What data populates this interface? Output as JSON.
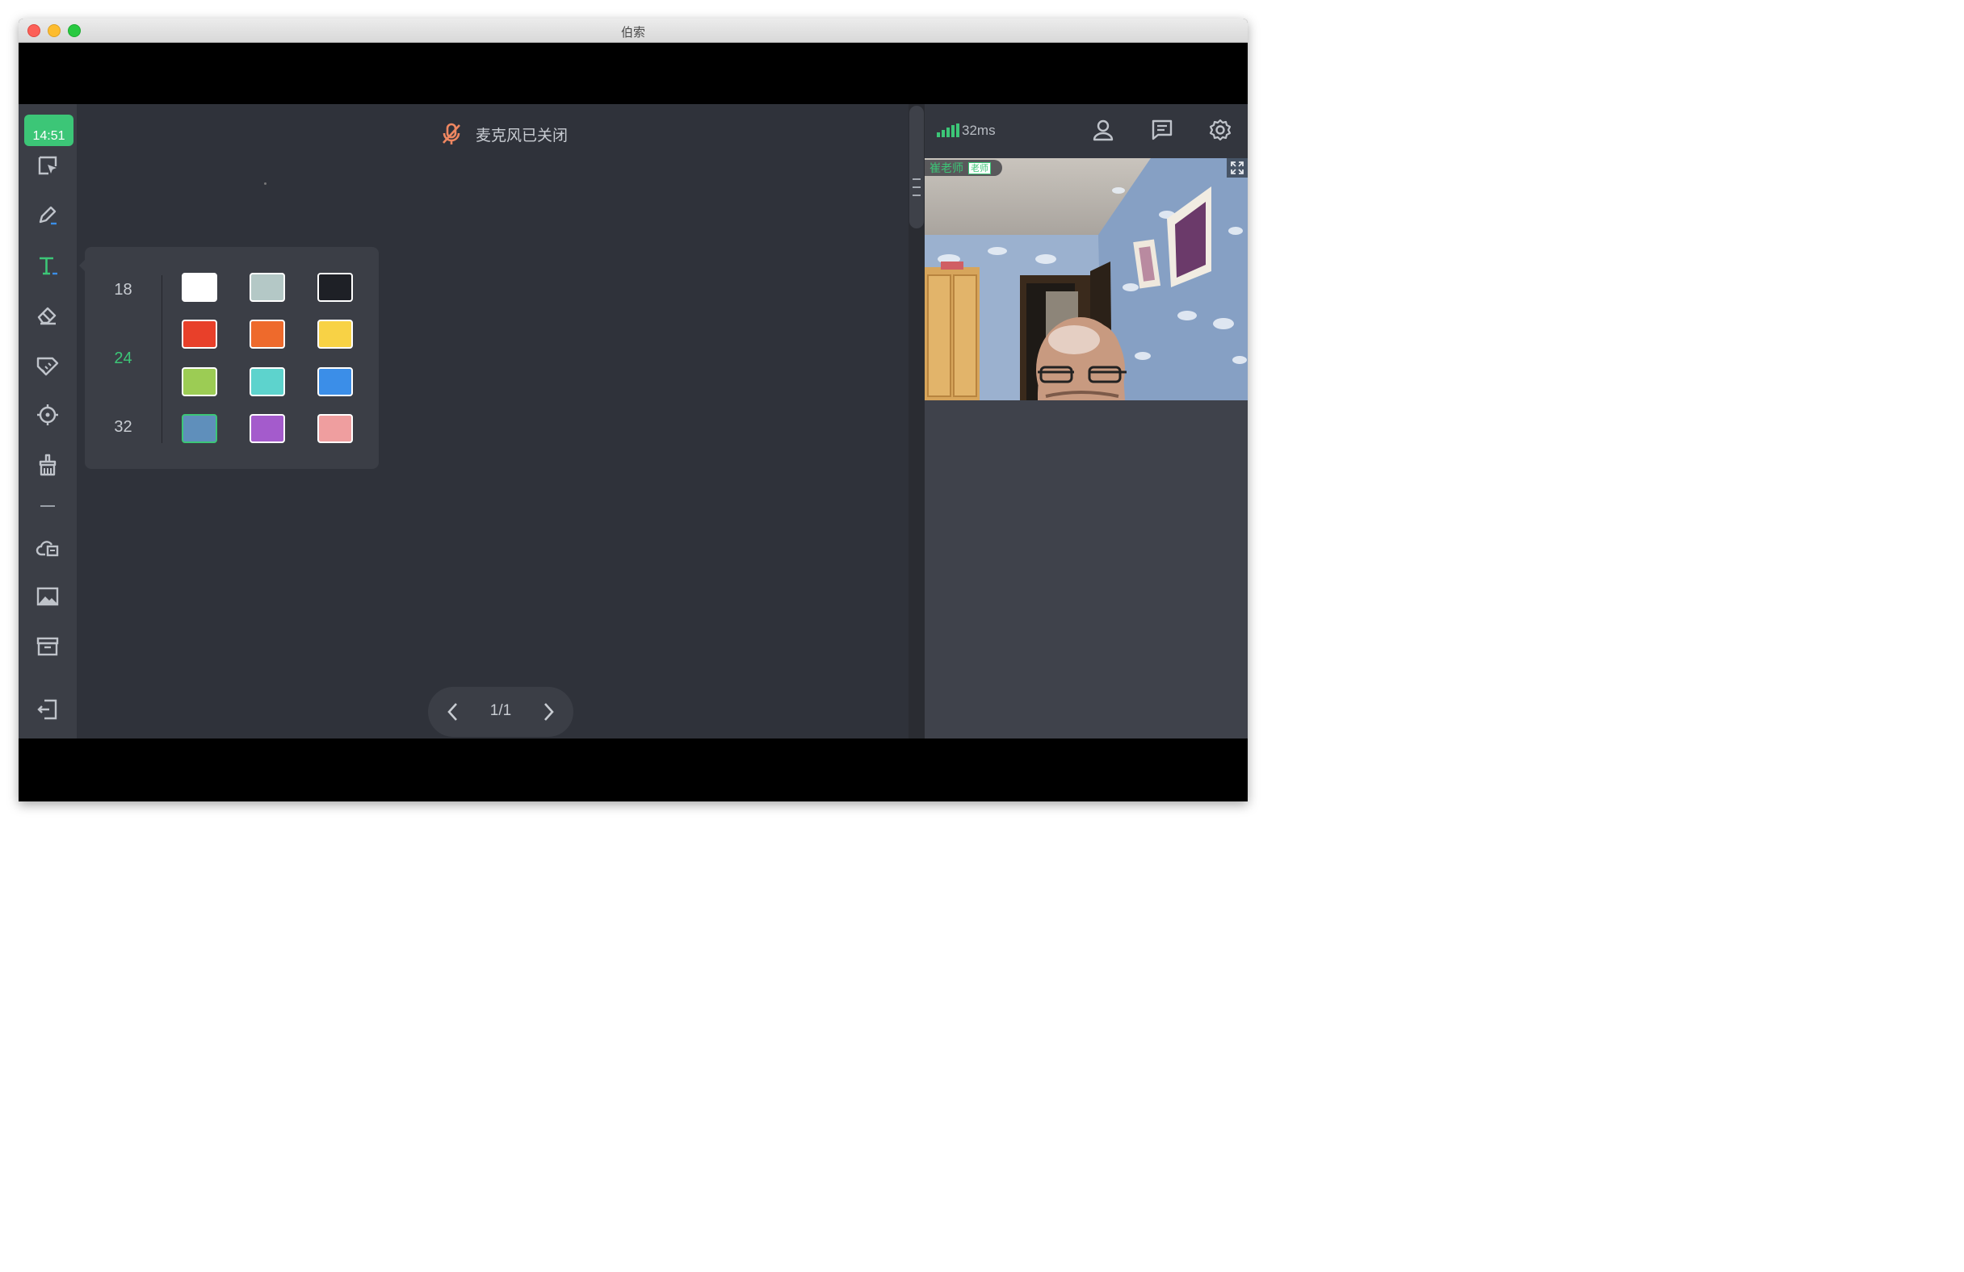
{
  "window": {
    "title": "伯索"
  },
  "sidebar": {
    "clock": "14:51",
    "tools": [
      "select-tool",
      "pen-tool",
      "text-tool",
      "eraser-tool",
      "ruler-tool",
      "laser-pointer-tool",
      "clear-tool",
      "cloud-files-tool",
      "image-tool",
      "archive-tool",
      "exit-tool"
    ],
    "active_tool": "text-tool"
  },
  "board": {
    "mic_status": "麦克风已关闭",
    "page_indicator": "1/1"
  },
  "text_panel": {
    "sizes": [
      "18",
      "24",
      "32"
    ],
    "active_size": "24",
    "colors": [
      "#ffffff",
      "#b4c8c6",
      "#1e2026",
      "#e8402a",
      "#ee6a2c",
      "#f8d245",
      "#9ccc54",
      "#5dd3cd",
      "#3b8ee8",
      "#5f8fbb",
      "#a45bcc",
      "#ef9e9f"
    ],
    "selected_color": "#5f8fbb"
  },
  "right_panel": {
    "latency": "32ms",
    "teacher_name": "崔老师",
    "teacher_badge": "老师"
  },
  "colors": {
    "accent": "#3cc677",
    "mic_off": "#ef8761"
  }
}
